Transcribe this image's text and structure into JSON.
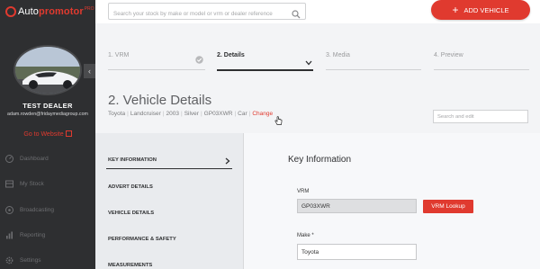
{
  "brand": {
    "name_part1": "Auto",
    "name_part2": "promotor",
    "badge": "PRO",
    "accent": "#e03a2f"
  },
  "sidebar": {
    "dealer_name": "TEST DEALER",
    "dealer_email": "adam.rowden@fridaymediagroup.com",
    "goto_website": "Go to Website",
    "collapse_icon": "chevron-left-icon",
    "nav": [
      {
        "label": "Dashboard",
        "icon": "dashboard-icon"
      },
      {
        "label": "My Stock",
        "icon": "stock-icon"
      },
      {
        "label": "Broadcasting",
        "icon": "broadcast-icon"
      },
      {
        "label": "Reporting",
        "icon": "reporting-icon"
      },
      {
        "label": "Settings",
        "icon": "settings-icon"
      }
    ]
  },
  "topbar": {
    "search_placeholder": "Search your stock by make or model or vrm or dealer reference",
    "search_icon": "search-icon",
    "add_vehicle": "ADD VEHICLE",
    "add_icon": "plus-icon"
  },
  "steps": [
    {
      "label": "1. VRM",
      "state": "complete"
    },
    {
      "label": "2. Details",
      "state": "active"
    },
    {
      "label": "3. Media",
      "state": "pending"
    },
    {
      "label": "4. Preview",
      "state": "pending"
    }
  ],
  "page": {
    "title": "2. Vehicle Details",
    "summary": [
      "Toyota",
      "Landcruiser",
      "2003",
      "Silver",
      "GP03XWR",
      "Car"
    ],
    "change_link": "Change",
    "search_edit_placeholder": "Search and edit"
  },
  "tabs": [
    {
      "label": "KEY INFORMATION",
      "active": true
    },
    {
      "label": "ADVERT DETAILS",
      "active": false
    },
    {
      "label": "VEHICLE DETAILS",
      "active": false
    },
    {
      "label": "PERFORMANCE & SAFETY",
      "active": false
    },
    {
      "label": "MEASUREMENTS",
      "active": false
    }
  ],
  "form": {
    "title": "Key Information",
    "vrm_label": "VRM",
    "vrm_value": "GP03XWR",
    "vrm_lookup": "VRM Lookup",
    "make_label": "Make *",
    "make_value": "Toyota"
  }
}
